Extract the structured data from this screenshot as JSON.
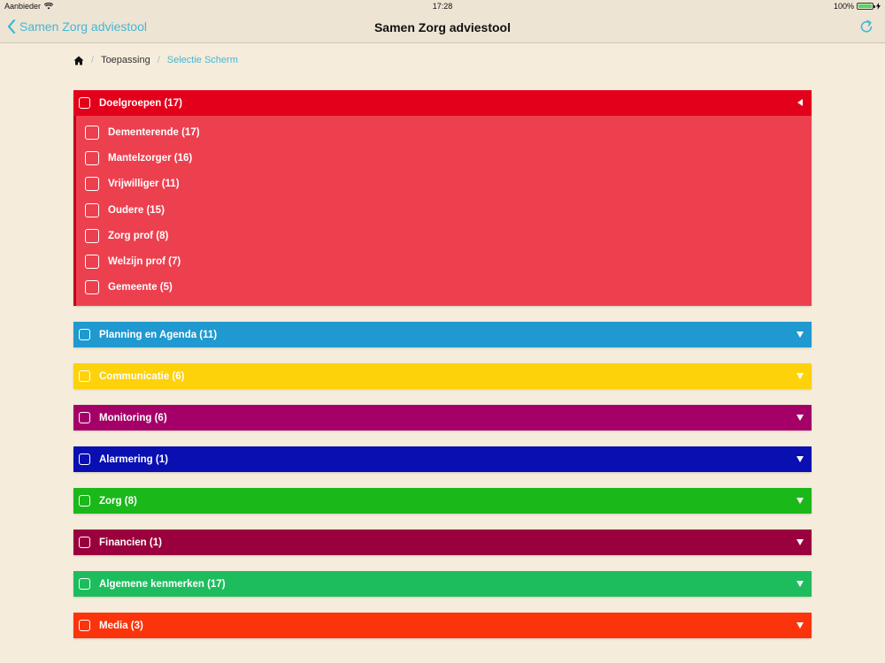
{
  "status": {
    "carrier": "Aanbieder",
    "time": "17:28",
    "battery": "100%",
    "battery_level": 1.0
  },
  "nav": {
    "back_label": "Samen Zorg adviestool",
    "title": "Samen Zorg adviestool"
  },
  "breadcrumb": {
    "items": [
      "Toepassing",
      "Selectie Scherm"
    ]
  },
  "categories": [
    {
      "label": "Doelgroepen (17)",
      "color": "#e3001b",
      "expanded": true,
      "items": [
        "Dementerende (17)",
        "Mantelzorger (16)",
        "Vrijwilliger (11)",
        "Oudere (15)",
        "Zorg prof (8)",
        "Welzijn prof (7)",
        "Gemeente (5)"
      ]
    },
    {
      "label": "Planning en Agenda (11)",
      "color": "#1f99cf",
      "expanded": false
    },
    {
      "label": "Communicatie (6)",
      "color": "#fdd20b",
      "expanded": false
    },
    {
      "label": "Monitoring (6)",
      "color": "#a50068",
      "expanded": false
    },
    {
      "label": "Alarmering (1)",
      "color": "#0a0fb2",
      "expanded": false
    },
    {
      "label": "Zorg (8)",
      "color": "#1bb81a",
      "expanded": false
    },
    {
      "label": "Financien (1)",
      "color": "#9b003e",
      "expanded": false
    },
    {
      "label": "Algemene kenmerken (17)",
      "color": "#1dbd5d",
      "expanded": false
    },
    {
      "label": "Media (3)",
      "color": "#fb340c",
      "expanded": false
    }
  ]
}
